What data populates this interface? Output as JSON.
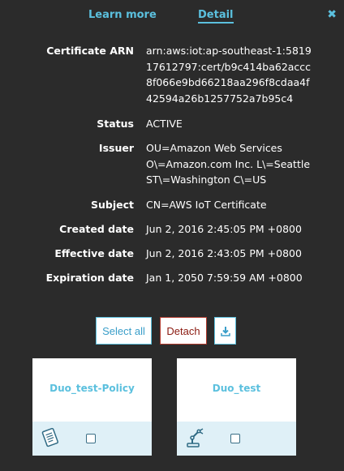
{
  "tabs": {
    "learn_more": "Learn more",
    "detail": "Detail"
  },
  "close_glyph": "✖",
  "details": [
    {
      "label": "Certificate ARN",
      "value": "arn:aws:iot:ap-southeast-1:581917612797:cert/b9c414ba62accc8f066e9bd66218aa296f8cdaa4f42594a26b1257752a7b95c4"
    },
    {
      "label": "Status",
      "value": "ACTIVE"
    },
    {
      "label": "Issuer",
      "value": "OU=Amazon Web Services O\\=Amazon.com Inc. L\\=Seattle ST\\=Washington C\\=US"
    },
    {
      "label": "Subject",
      "value": "CN=AWS IoT Certificate"
    },
    {
      "label": "Created date",
      "value": "Jun 2, 2016 2:45:05 PM +0800"
    },
    {
      "label": "Effective date",
      "value": "Jun 2, 2016 2:43:05 PM +0800"
    },
    {
      "label": "Expiration date",
      "value": "Jan 1, 2050 7:59:59 AM +0800"
    }
  ],
  "actions": {
    "select_all": "Select all",
    "detach": "Detach",
    "download_icon": "download-icon"
  },
  "cards": [
    {
      "title": "Duo_test-Policy",
      "icon": "policy-document-icon"
    },
    {
      "title": "Duo_test",
      "icon": "robot-arm-icon"
    }
  ],
  "colors": {
    "background": "#2b2b2b",
    "accent": "#5bc0de",
    "danger": "#8b1a10",
    "card_footer": "#dff0f7"
  }
}
